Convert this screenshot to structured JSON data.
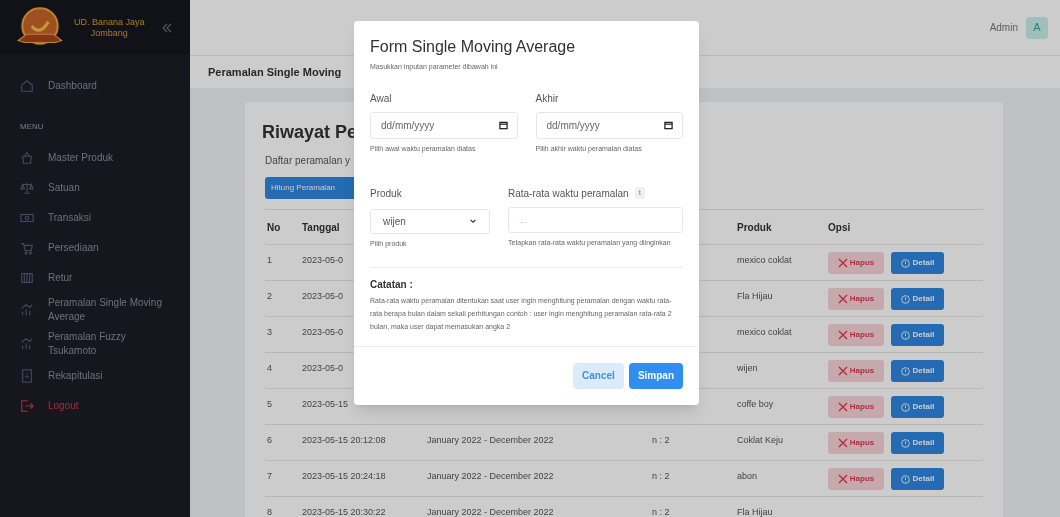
{
  "brand": {
    "line1": "UD. Banana Jaya",
    "line2": "Jombang"
  },
  "sidebar": {
    "items": [
      {
        "kind": "link",
        "label": "Dashboard"
      },
      {
        "kind": "section",
        "label": "MENU"
      },
      {
        "kind": "link",
        "label": "Master Produk"
      },
      {
        "kind": "link",
        "label": "Satuan"
      },
      {
        "kind": "link",
        "label": "Transaksi"
      },
      {
        "kind": "link",
        "label": "Persediaan"
      },
      {
        "kind": "link",
        "label": "Retur"
      },
      {
        "kind": "link",
        "label": "Peramalan Single Moving Average"
      },
      {
        "kind": "link",
        "label": "Peramalan Fuzzy Tsukamoto"
      },
      {
        "kind": "link",
        "label": "Rekapitulasi"
      },
      {
        "kind": "logout",
        "label": "Logout"
      }
    ]
  },
  "topbar": {
    "user": "Admin",
    "avatar": "A"
  },
  "page_header": "Peramalan Single Moving",
  "card": {
    "title": "Riwayat Pe",
    "subtitle": "Daftar peramalan y",
    "button": "Hitung Peramalan"
  },
  "table": {
    "columns": {
      "no": "No",
      "tanggal": "Tanggal",
      "produk": "Produk",
      "opsi": "Opsi"
    },
    "rows": [
      {
        "no": "1",
        "tanggal": "2023-05-0",
        "produk": "mexico coklat",
        "delete": "Hapus",
        "detail": "Detail"
      },
      {
        "no": "2",
        "tanggal": "2023-05-0",
        "produk": "Fla Hijau",
        "delete": "Hapus",
        "detail": "Detail"
      },
      {
        "no": "3",
        "tanggal": "2023-05-0",
        "produk": "mexico coklat",
        "delete": "Hapus",
        "detail": "Detail"
      },
      {
        "no": "4",
        "tanggal": "2023-05-0",
        "produk": "wijen",
        "delete": "Hapus",
        "detail": "Detail"
      },
      {
        "no": "5",
        "tanggal": "2023-05-15",
        "produk": "coffe boy",
        "delete": "Hapus",
        "detail": "Detail"
      },
      {
        "no": "6",
        "tanggal": "2023-05-15 20:12:08",
        "periode": "January 2022 - December 2022",
        "n": "n : 2",
        "produk": "Coklat Keju",
        "delete": "Hapus",
        "detail": "Detail"
      },
      {
        "no": "7",
        "tanggal": "2023-05-15 20:24:18",
        "periode": "January 2022 - December 2022",
        "n": "n : 2",
        "produk": "abon",
        "delete": "Hapus",
        "detail": "Detail"
      },
      {
        "no": "8",
        "tanggal": "2023-05-15 20:30:22",
        "periode": "January 2022 - December 2022",
        "n": "n : 2",
        "produk": "Fla Hijau"
      }
    ]
  },
  "modal": {
    "title": "Form Single Moving Average",
    "subtitle": "Masukkan inputan parameter dibawah ini",
    "fields": [
      {
        "kind": "date",
        "label": "Awal",
        "placeholder": "dd/mm/yyyy",
        "hint": "Pilih awal waktu peramalan diatas"
      },
      {
        "kind": "date",
        "label": "Akhir",
        "placeholder": "dd/mm/yyyy",
        "hint": "Pilih akhir waktu peramalan diatas"
      },
      {
        "kind": "select",
        "label": "Produk",
        "value": "wijen",
        "hint": "Pilih produk"
      },
      {
        "kind": "number",
        "label": "Rata-rata waktu peramalan",
        "badge": "t",
        "placeholder": "...",
        "hint": "Tetapkan rata-rata waktu peramalan yang diinginkan"
      }
    ],
    "note_title": "Catatan :",
    "note": "Rata-rata waktu peramalan ditentukan saat user ingin menghitung peramalan dengan waktu rata-rata berapa bulan dalam sekali perhitungan contoh : user ingin menghitung peramalan rata-rata 2 bulan, maka user dapat memasukan angka 2",
    "buttons": [
      {
        "kind": "secondary",
        "label": "Cancel"
      },
      {
        "kind": "primary",
        "label": "Simpan"
      }
    ]
  }
}
